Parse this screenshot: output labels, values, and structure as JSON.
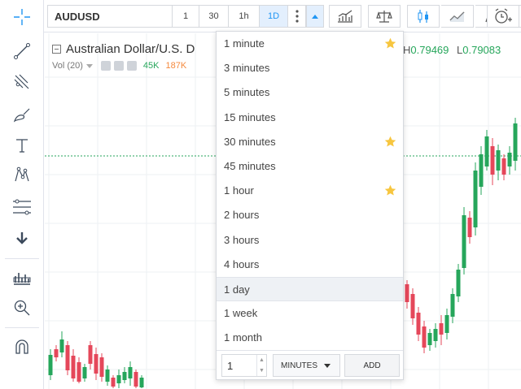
{
  "toolbar": {
    "symbol": "AUDUSD",
    "timeframes": [
      "1",
      "30",
      "1h",
      "1D"
    ],
    "active_timeframe": "1D"
  },
  "legend": {
    "title": "Australian Dollar/U.S. D",
    "vol_label": "Vol (20)",
    "vol_value_1": "45K",
    "vol_value_2": "187K",
    "high_label": "H",
    "high_value": "0.79469",
    "low_label": "L",
    "low_value": "0.79083"
  },
  "interval_menu": {
    "items": [
      {
        "label": "1 minute",
        "favorite": true
      },
      {
        "label": "3 minutes",
        "favorite": false
      },
      {
        "label": "5 minutes",
        "favorite": false
      },
      {
        "label": "15 minutes",
        "favorite": false
      },
      {
        "label": "30 minutes",
        "favorite": true
      },
      {
        "label": "45 minutes",
        "favorite": false
      },
      {
        "label": "1 hour",
        "favorite": true
      },
      {
        "label": "2 hours",
        "favorite": false
      },
      {
        "label": "3 hours",
        "favorite": false
      },
      {
        "label": "4 hours",
        "favorite": false
      },
      {
        "label": "1 day",
        "favorite": false
      },
      {
        "label": "1 week",
        "favorite": false
      },
      {
        "label": "1 month",
        "favorite": false
      }
    ],
    "selected": "1 day",
    "custom_value": "1",
    "custom_unit": "MINUTES",
    "add_label": "ADD"
  },
  "colors": {
    "accent": "#2196f3",
    "up": "#26a65b",
    "down": "#e5475a",
    "star": "#f7c63f"
  },
  "icons": {
    "left_toolbar": [
      "crosshair-icon",
      "trend-line-icon",
      "pitchfork-icon",
      "brush-icon",
      "text-icon",
      "pattern-icon",
      "prediction-icon",
      "arrow-down-icon",
      "long-position-icon",
      "zoom-icon",
      "magnet-icon"
    ],
    "top_toolbar": [
      "more-icon",
      "caret-up-icon",
      "indicators-icon",
      "compare-icon",
      "candles-icon",
      "line-chart-icon",
      "templates-icon",
      "caret-down-icon",
      "alert-icon"
    ]
  }
}
